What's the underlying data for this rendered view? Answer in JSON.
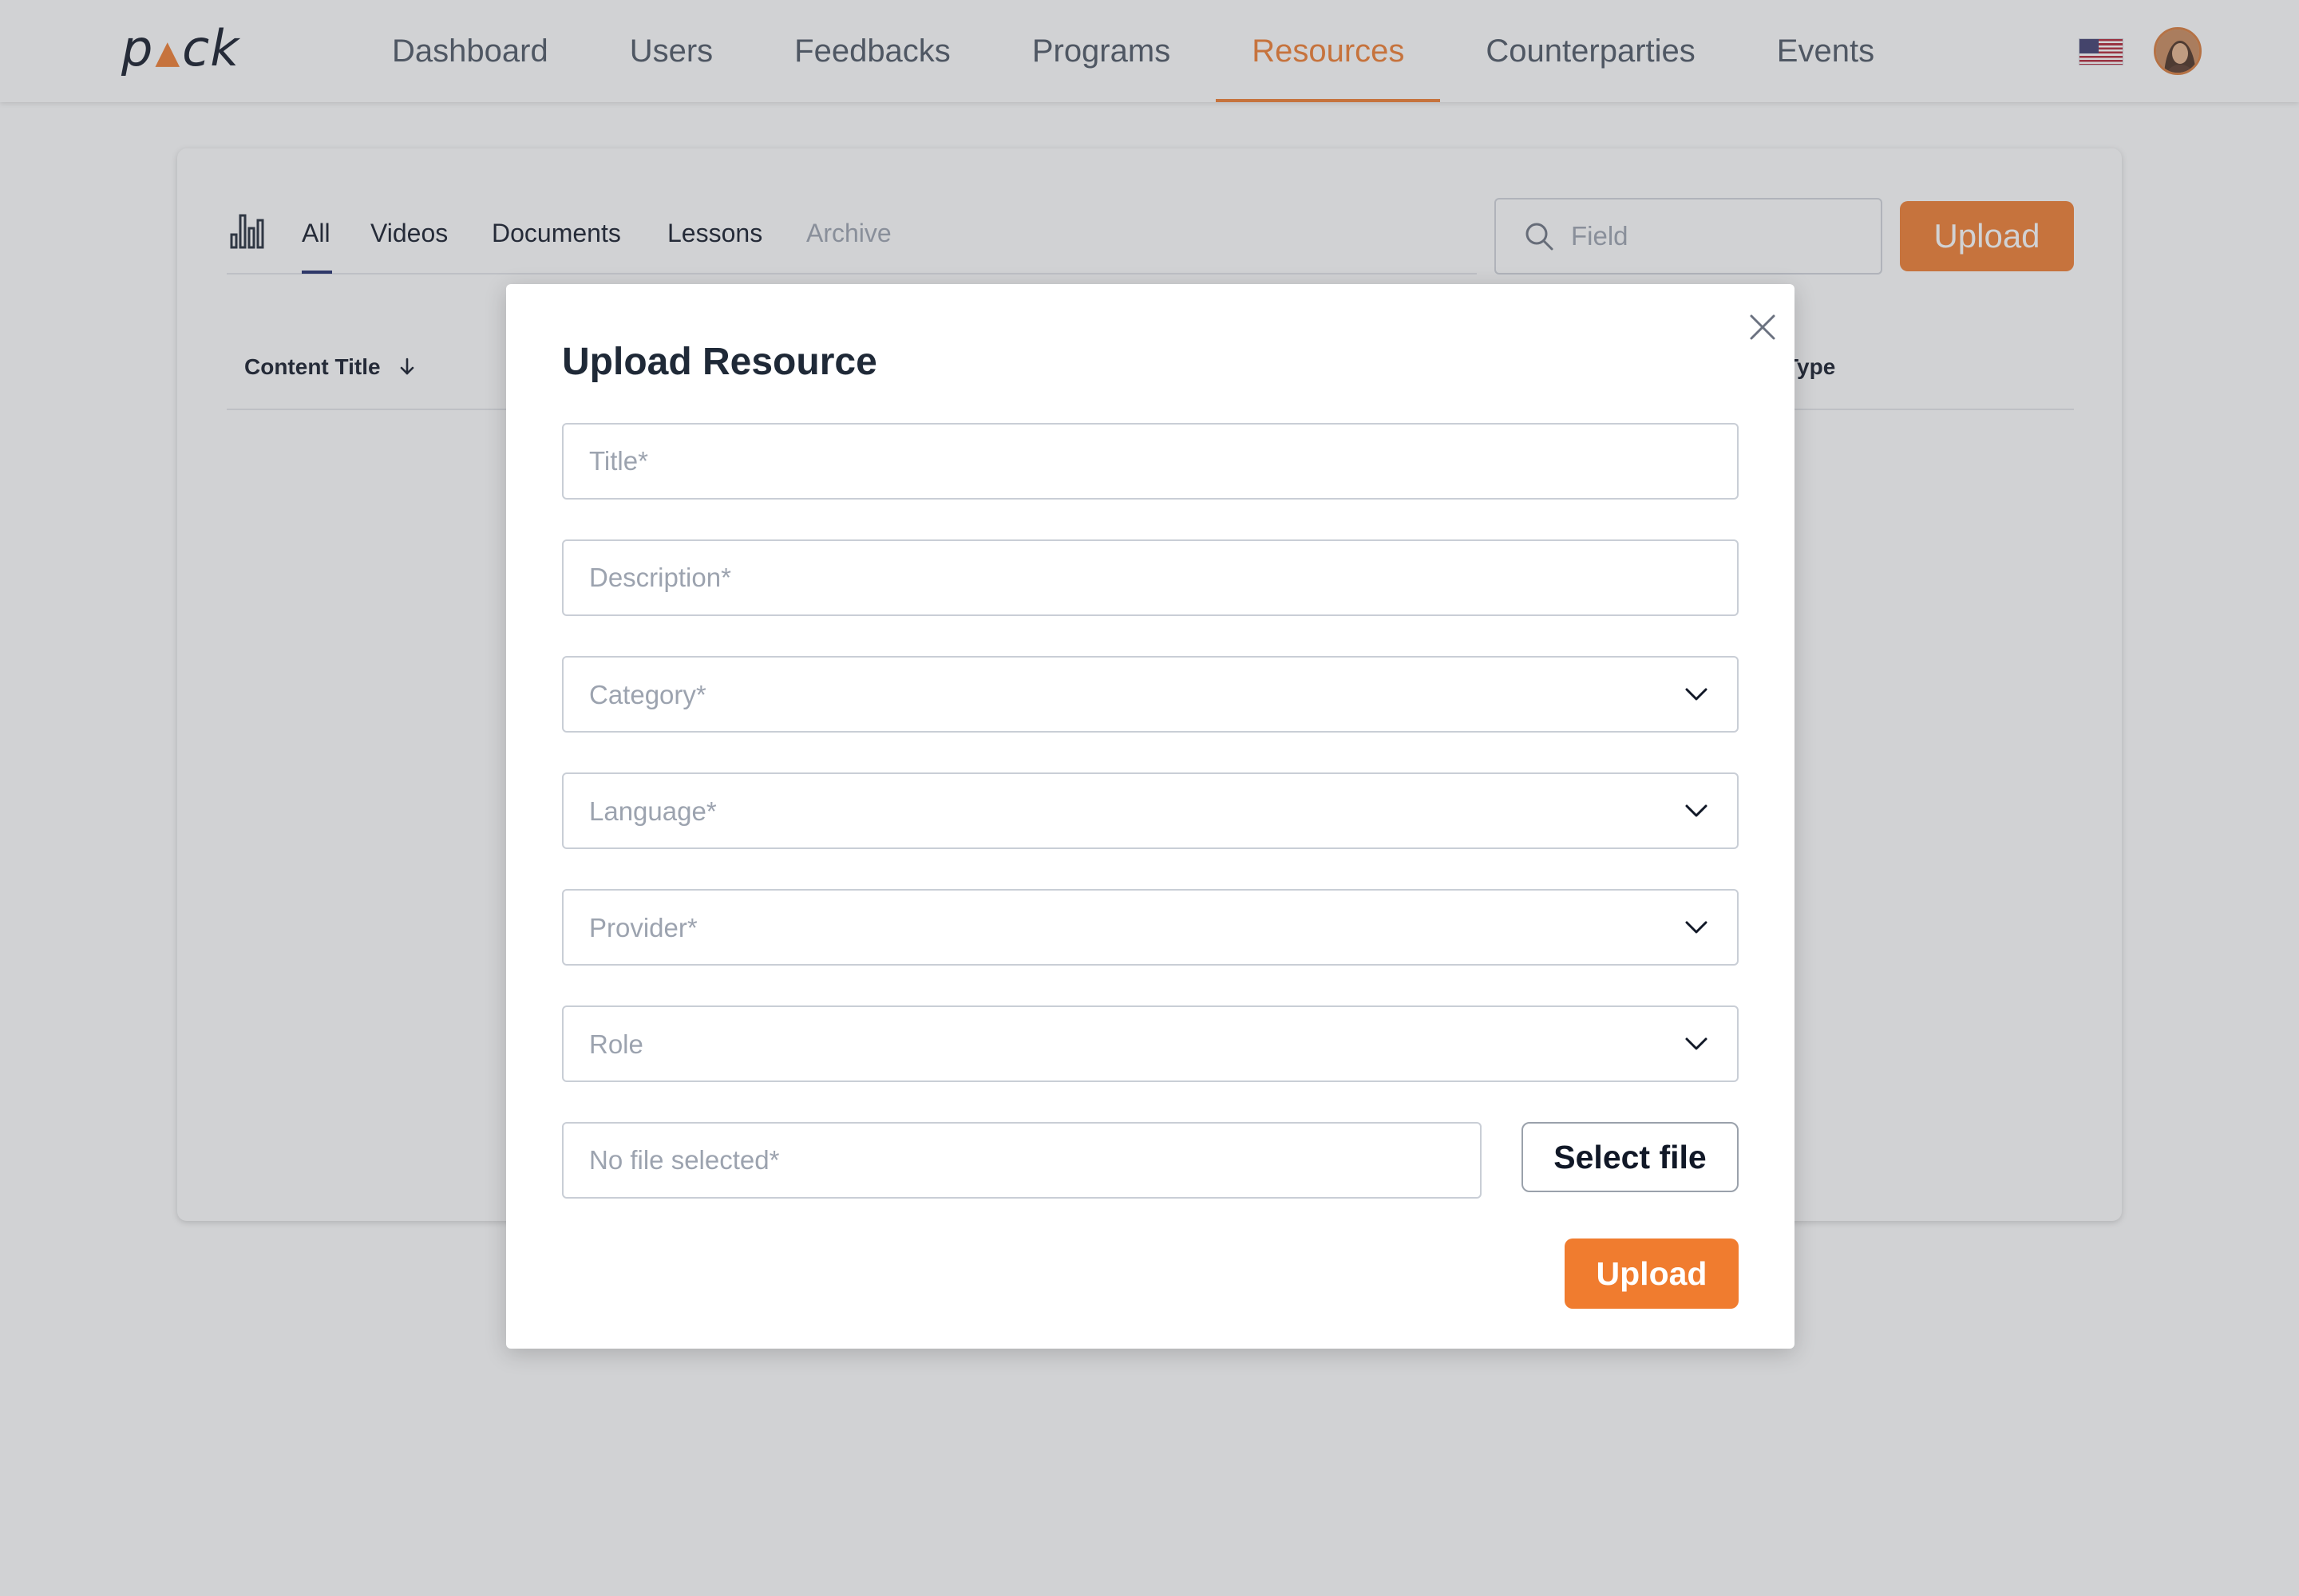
{
  "app": {
    "logo": "pack"
  },
  "nav": {
    "items": [
      {
        "label": "Dashboard"
      },
      {
        "label": "Users"
      },
      {
        "label": "Feedbacks"
      },
      {
        "label": "Programs"
      },
      {
        "label": "Resources",
        "active": true
      },
      {
        "label": "Counterparties"
      },
      {
        "label": "Events"
      }
    ],
    "flag_icon": "us-flag-icon",
    "avatar_icon": "user-avatar"
  },
  "resources": {
    "tabs": [
      {
        "label": "All",
        "active": true
      },
      {
        "label": "Videos"
      },
      {
        "label": "Documents"
      },
      {
        "label": "Lessons"
      },
      {
        "label": "Archive",
        "muted": true
      }
    ],
    "search": {
      "placeholder": "Field",
      "icon": "search-icon"
    },
    "upload_label": "Upload",
    "table": {
      "headers": [
        {
          "label": "Content Title",
          "sort": "desc"
        },
        {
          "label": "Type"
        }
      ]
    }
  },
  "modal": {
    "title": "Upload Resource",
    "fields": {
      "title": {
        "placeholder": "Title*"
      },
      "description": {
        "placeholder": "Description*"
      },
      "category": {
        "placeholder": "Category*"
      },
      "language": {
        "placeholder": "Language*"
      },
      "provider": {
        "placeholder": "Provider*"
      },
      "role": {
        "placeholder": "Role"
      },
      "file": {
        "placeholder": "No file selected*"
      }
    },
    "select_file_label": "Select file",
    "upload_label": "Upload"
  },
  "colors": {
    "accent": "#f07c2f",
    "tab_active_underline": "#1e2a6b",
    "overlay": "#585c64"
  }
}
